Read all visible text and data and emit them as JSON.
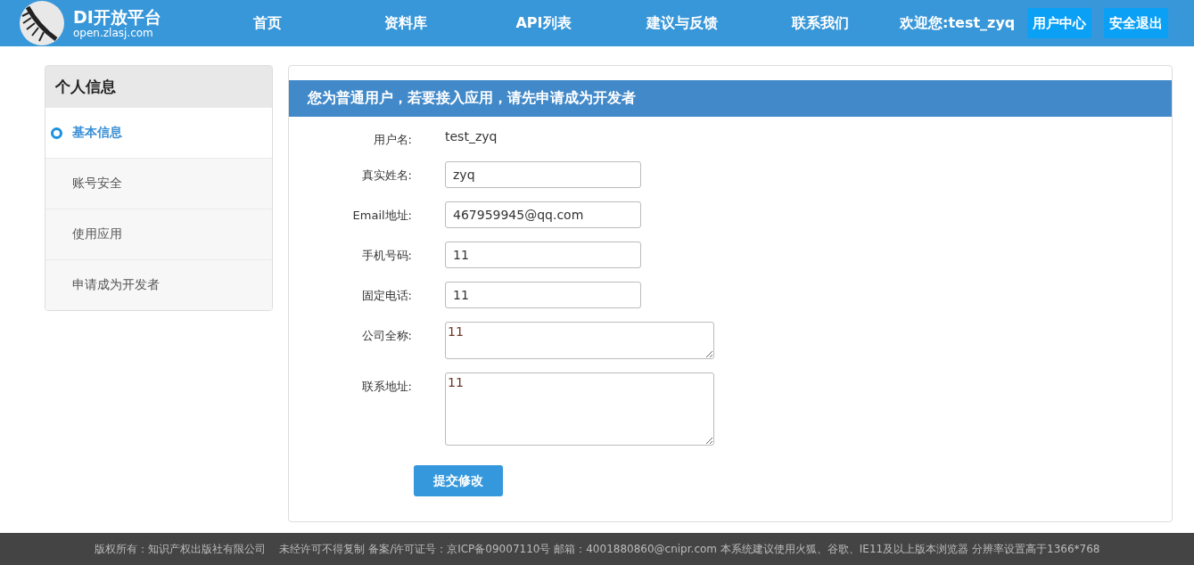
{
  "header": {
    "logo_title": "DI开放平台",
    "logo_subtitle": "open.zlasj.com",
    "nav": [
      {
        "label": "首页"
      },
      {
        "label": "资料库"
      },
      {
        "label": "API列表"
      },
      {
        "label": "建议与反馈"
      },
      {
        "label": "联系我们"
      }
    ],
    "welcome": "欢迎您:test_zyq",
    "buttons": [
      "用户中心",
      "安全退出"
    ]
  },
  "sidebar": {
    "title": "个人信息",
    "items": [
      {
        "label": "基本信息",
        "selected": true
      },
      {
        "label": "账号安全",
        "selected": false
      },
      {
        "label": "使用应用",
        "selected": false
      },
      {
        "label": "申请成为开发者",
        "selected": false
      }
    ]
  },
  "main": {
    "banner": "您为普通用户，若要接入应用，请先申请成为开发者",
    "fields": [
      {
        "kind": "static",
        "label": "用户名:",
        "value": "test_zyq"
      },
      {
        "kind": "input",
        "label": "真实姓名:",
        "value": "zyq"
      },
      {
        "kind": "input",
        "label": "Email地址:",
        "value": "467959945@qq.com"
      },
      {
        "kind": "input",
        "label": "手机号码:",
        "value": "11"
      },
      {
        "kind": "input",
        "label": "固定电话:",
        "value": "11"
      },
      {
        "kind": "textarea",
        "label": "公司全称:",
        "value": "11"
      },
      {
        "kind": "textarea",
        "label": "联系地址:",
        "value": "11"
      }
    ],
    "submit": "提交修改"
  },
  "footer": "版权所有：知识产权出版社有限公司　 未经许可不得复制  备案/许可证号：京ICP备09007110号  邮箱：4001880860@cnipr.com  本系统建议使用火狐、谷歌、IE11及以上版本浏览器 分辨率设置高于1366*768"
}
